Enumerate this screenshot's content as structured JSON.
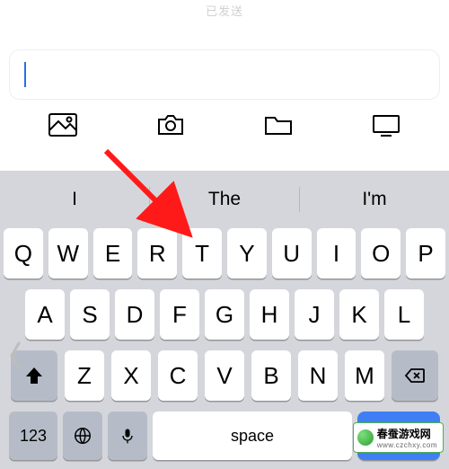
{
  "status_text": "已发送",
  "input": {
    "value": ""
  },
  "suggestions": [
    "I",
    "The",
    "I'm"
  ],
  "keyboard": {
    "row1": [
      "Q",
      "W",
      "E",
      "R",
      "T",
      "Y",
      "U",
      "I",
      "O",
      "P"
    ],
    "row2": [
      "A",
      "S",
      "D",
      "F",
      "G",
      "H",
      "J",
      "K",
      "L"
    ],
    "row3": [
      "Z",
      "X",
      "C",
      "V",
      "B",
      "N",
      "M"
    ],
    "numeric_label": "123",
    "space_label": "space"
  },
  "watermark": {
    "title": "春蚕游戏网",
    "url": "www.czchxy.com"
  },
  "colors": {
    "accent": "#3f7ef5",
    "arrow": "#ff1a1a",
    "keyboard_bg": "#d4d6db"
  }
}
